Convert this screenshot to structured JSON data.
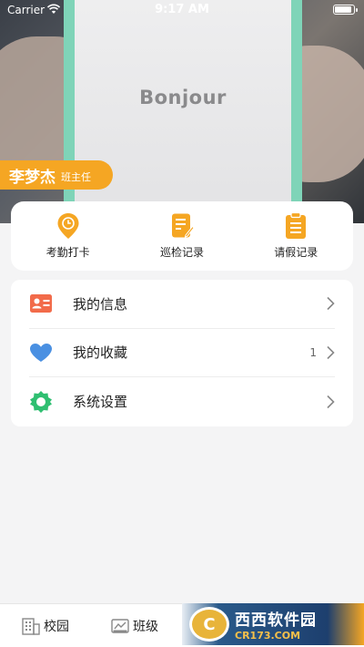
{
  "status_bar": {
    "carrier": "Carrier",
    "time": "9:17 AM"
  },
  "header": {
    "photo_text": "Bonjour",
    "user_name": "李梦杰",
    "user_role": "班主任"
  },
  "quick_actions": [
    {
      "label": "考勤打卡",
      "icon": "location-pin-icon"
    },
    {
      "label": "巡检记录",
      "icon": "edit-document-icon"
    },
    {
      "label": "请假记录",
      "icon": "clipboard-icon"
    }
  ],
  "menu": [
    {
      "label": "我的信息",
      "icon": "id-card-icon",
      "count": ""
    },
    {
      "label": "我的收藏",
      "icon": "heart-icon",
      "count": "1"
    },
    {
      "label": "系统设置",
      "icon": "settings-icon",
      "count": ""
    }
  ],
  "bottom_nav": [
    {
      "label": "校园",
      "icon": "building-icon"
    },
    {
      "label": "班级",
      "icon": "class-icon"
    }
  ],
  "watermark": {
    "title": "西西软件园",
    "subtitle": "CR173.COM"
  },
  "colors": {
    "accent": "#f5a623",
    "id_card": "#f26b4a",
    "heart": "#4a90e2",
    "settings": "#2fbf71"
  }
}
